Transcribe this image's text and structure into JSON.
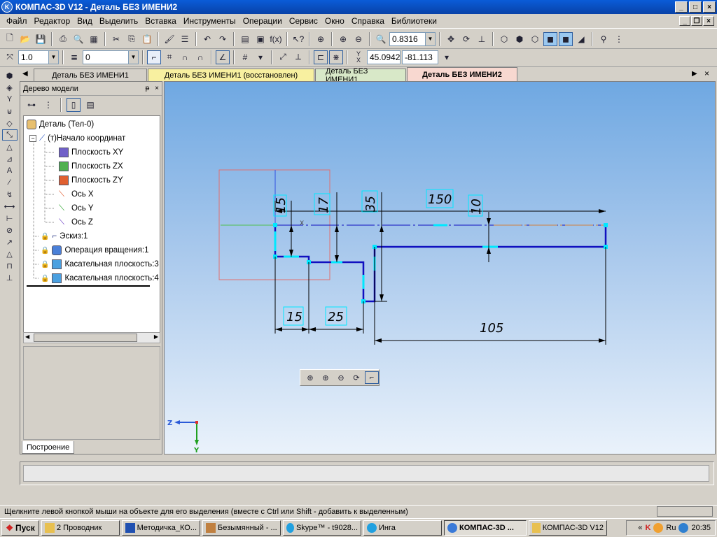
{
  "window": {
    "title": "КОМПАС-3D V12 - Деталь БЕЗ ИМЕНИ2",
    "app_icon": "kompas-logo-icon"
  },
  "menu": [
    "Файл",
    "Редактор",
    "Вид",
    "Выделить",
    "Вставка",
    "Инструменты",
    "Операции",
    "Сервис",
    "Окно",
    "Справка",
    "Библиотеки"
  ],
  "toolbar1": {
    "zoom_value": "0.8316"
  },
  "toolbar2": {
    "line_width": "1.0",
    "layer": "0",
    "y_label": "Y",
    "x_label": "X",
    "coord_x": "45.0942",
    "coord_y": "-81.113"
  },
  "tabs": [
    "Деталь БЕЗ ИМЕНИ1",
    "Деталь БЕЗ ИМЕНИ1 (восстановлен)",
    "Деталь БЕЗ ИМЕНИ1",
    "Деталь БЕЗ ИМЕНИ2"
  ],
  "tree": {
    "title": "Дерево модели",
    "pin": "ᵽ",
    "close": "×",
    "items": [
      {
        "label": "Деталь (Тел-0)"
      },
      {
        "label": "(т)Начало координат"
      },
      {
        "label": "Плоскость XY"
      },
      {
        "label": "Плоскость ZX"
      },
      {
        "label": "Плоскость ZY"
      },
      {
        "label": "Ось X"
      },
      {
        "label": "Ось Y"
      },
      {
        "label": "Ось Z"
      },
      {
        "label": "Эскиз:1"
      },
      {
        "label": "Операция вращения:1"
      },
      {
        "label": "Касательная плоскость:3"
      },
      {
        "label": "Касательная плоскость:4"
      }
    ],
    "bottom_tab": "Построение"
  },
  "drawing": {
    "dims": {
      "d15v": "15",
      "d17": "17",
      "d35": "35",
      "d150": "150",
      "d10": "10",
      "d15h": "15",
      "d25": "25",
      "d105": "105"
    },
    "axis_x_mark": "X",
    "triad_z": "Z",
    "triad_y": "Y"
  },
  "status": "Щелкните левой кнопкой мыши на объекте для его выделения (вместе с Ctrl или Shift - добавить к выделенным)",
  "taskbar": {
    "start": "Пуск",
    "tasks": [
      "2 Проводник",
      "Методичка_КО...",
      "Безымянный - ...",
      "Skype™ - t9028...",
      "Инга",
      "КОМПАС-3D ...",
      "КОМПАС-3D V12"
    ],
    "lang": "Ru",
    "time": "20:35"
  },
  "colors": {
    "sketch_line": "#1010c0",
    "dimension_box": "#00e8ff",
    "selection_rect": "#e07070",
    "axis_z": "#2a5ad8",
    "axis_y": "#20a020"
  }
}
